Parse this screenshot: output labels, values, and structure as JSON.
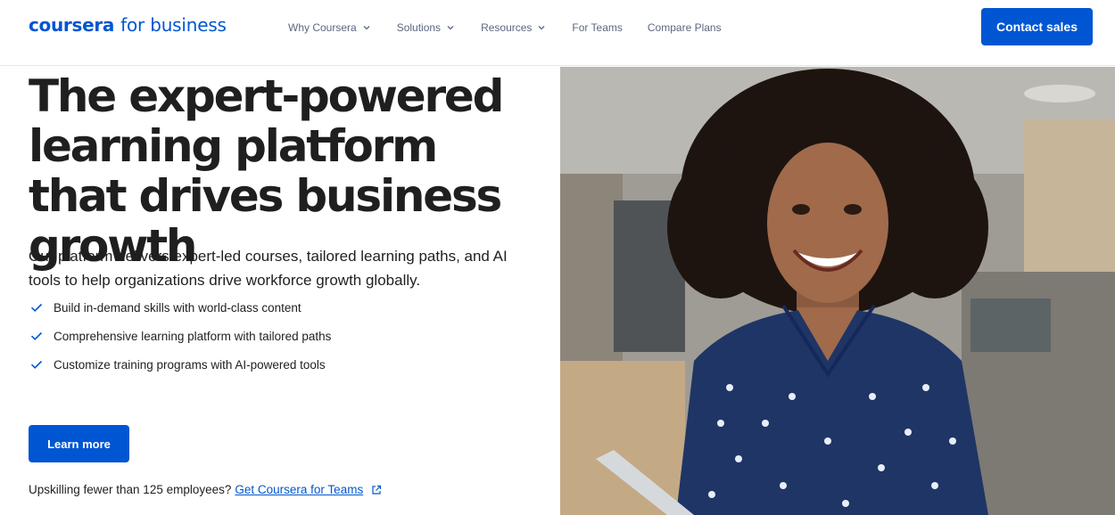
{
  "header": {
    "logo_brand": "coursera",
    "logo_suffix": "for business",
    "nav": [
      {
        "label": "Why Coursera",
        "has_dropdown": true
      },
      {
        "label": "Solutions",
        "has_dropdown": true
      },
      {
        "label": "Resources",
        "has_dropdown": true
      },
      {
        "label": "For Teams",
        "has_dropdown": false
      },
      {
        "label": "Compare Plans",
        "has_dropdown": false
      }
    ],
    "contact_label": "Contact sales"
  },
  "hero": {
    "title": "The expert-powered learning platform that drives business growth",
    "description": "Our platform delivers expert-led courses, tailored learning paths, and AI tools to help organizations drive workforce growth globally.",
    "bullets": [
      "Build in-demand skills with world-class content",
      "Comprehensive learning platform with tailored paths",
      "Customize training programs with AI-powered tools"
    ],
    "cta_label": "Learn more",
    "footnote_text": "Upskilling fewer than 125 employees?",
    "footnote_link": "Get Coursera for Teams"
  },
  "icons": {
    "nav_dropdown": "chevron-down-icon",
    "bullet": "check-icon",
    "link": "external-link-icon"
  },
  "colors": {
    "brand": "#0056d2",
    "text": "#1f1f1f",
    "nav_text": "#5b6780"
  }
}
